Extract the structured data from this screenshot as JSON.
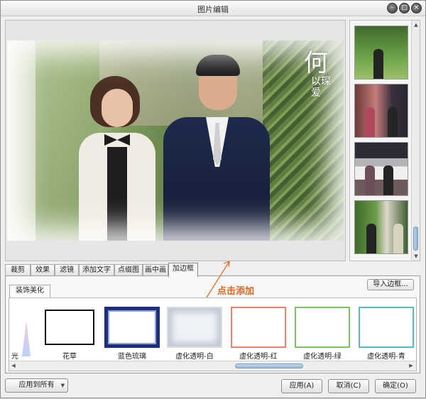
{
  "window": {
    "title": "图片编辑",
    "controls": {
      "minimize": "–",
      "maximize": "□",
      "close": "×"
    }
  },
  "preview": {
    "calligraphy": "何",
    "calligraphy_small": "以琛爱"
  },
  "thumbnails": [
    "thumb-1",
    "thumb-2",
    "thumb-3",
    "thumb-4"
  ],
  "tabs": [
    {
      "label": "裁剪",
      "active": false
    },
    {
      "label": "效果",
      "active": false
    },
    {
      "label": "滤镜",
      "active": false
    },
    {
      "label": "添加文字",
      "active": false
    },
    {
      "label": "点缀图",
      "active": false
    },
    {
      "label": "画中画",
      "active": false
    },
    {
      "label": "加边框",
      "active": true
    }
  ],
  "border_panel": {
    "subtab": "装饰美化",
    "import_button": "导入边框...",
    "frames": [
      {
        "label": "光",
        "partial": true
      },
      {
        "label": "花草"
      },
      {
        "label": "蓝色琉璃"
      },
      {
        "label": "虚化透明-白",
        "selected": true
      },
      {
        "label": "虚化透明-红"
      },
      {
        "label": "虚化透明-绿"
      },
      {
        "label": "虚化透明-青"
      }
    ]
  },
  "annotation": {
    "hint": "点击添加",
    "color": "#e0661e"
  },
  "footer": {
    "apply_all": "应用到所有",
    "apply": "应用(A)",
    "cancel": "取消(C)",
    "ok": "确定(O)"
  }
}
